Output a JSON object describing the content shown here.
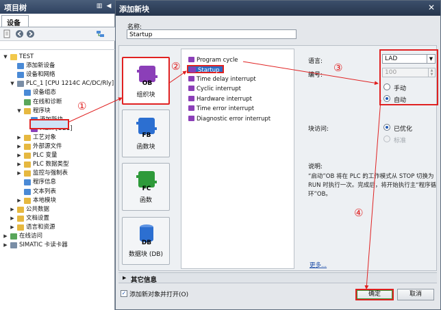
{
  "project_panel": {
    "title": "项目树",
    "tab": "设备",
    "tree": [
      {
        "label": "TEST",
        "indent": 0,
        "arrow": "▼",
        "icon": "project-icon",
        "color": "#f2c84b"
      },
      {
        "label": "添加新设备",
        "indent": 1,
        "arrow": "",
        "icon": "add-device-icon",
        "color": "#4a8ad6"
      },
      {
        "label": "设备和网络",
        "indent": 1,
        "arrow": "",
        "icon": "network-icon",
        "color": "#4a8ad6"
      },
      {
        "label": "PLC_1 [CPU 1214C AC/DC/Rly]",
        "indent": 1,
        "arrow": "▼",
        "icon": "plc-icon",
        "color": "#7a8ea6"
      },
      {
        "label": "设备组态",
        "indent": 2,
        "arrow": "",
        "icon": "device-config-icon",
        "color": "#4a8ad6"
      },
      {
        "label": "在线和诊断",
        "indent": 2,
        "arrow": "",
        "icon": "online-diagnostics-icon",
        "color": "#5aa65a"
      },
      {
        "label": "程序块",
        "indent": 2,
        "arrow": "▼",
        "icon": "folder-icon",
        "color": "#e6b840"
      },
      {
        "label": "添加新块",
        "indent": 3,
        "arrow": "",
        "icon": "add-block-icon",
        "color": "#4a8ad6"
      },
      {
        "label": "Main [OB1]",
        "indent": 3,
        "arrow": "",
        "icon": "ob-block-icon",
        "color": "#8b3fb8"
      },
      {
        "label": "工艺对象",
        "indent": 2,
        "arrow": "▶",
        "icon": "folder-icon",
        "color": "#e6b840"
      },
      {
        "label": "外部源文件",
        "indent": 2,
        "arrow": "▶",
        "icon": "folder-icon",
        "color": "#e6b840"
      },
      {
        "label": "PLC 变量",
        "indent": 2,
        "arrow": "▶",
        "icon": "folder-icon",
        "color": "#e6b840"
      },
      {
        "label": "PLC 数据类型",
        "indent": 2,
        "arrow": "▶",
        "icon": "folder-icon",
        "color": "#e6b840"
      },
      {
        "label": "监控与强制表",
        "indent": 2,
        "arrow": "▶",
        "icon": "folder-icon",
        "color": "#e6b840"
      },
      {
        "label": "程序信息",
        "indent": 2,
        "arrow": "",
        "icon": "program-info-icon",
        "color": "#4a8ad6"
      },
      {
        "label": "文本列表",
        "indent": 2,
        "arrow": "",
        "icon": "text-list-icon",
        "color": "#4a8ad6"
      },
      {
        "label": "本地模块",
        "indent": 2,
        "arrow": "▶",
        "icon": "folder-icon",
        "color": "#e6b840"
      },
      {
        "label": "公共数据",
        "indent": 1,
        "arrow": "▶",
        "icon": "folder-icon",
        "color": "#e6b840"
      },
      {
        "label": "文档设置",
        "indent": 1,
        "arrow": "▶",
        "icon": "folder-icon",
        "color": "#e6b840"
      },
      {
        "label": "语言和资源",
        "indent": 1,
        "arrow": "▶",
        "icon": "folder-icon",
        "color": "#e6b840"
      },
      {
        "label": "在线访问",
        "indent": 0,
        "arrow": "▶",
        "icon": "online-access-icon",
        "color": "#5aa65a"
      },
      {
        "label": "SIMATIC 卡读卡器",
        "indent": 0,
        "arrow": "▶",
        "icon": "card-reader-icon",
        "color": "#7a8ea6"
      }
    ]
  },
  "dialog": {
    "title": "添加新块",
    "close": "✕",
    "name_label": "名称:",
    "name_value": "Startup",
    "block_types": [
      {
        "code": "OB",
        "label": "组织块",
        "color": "#8b3fb8",
        "icon": "organization-block-icon"
      },
      {
        "code": "FB",
        "label": "函数块",
        "color": "#2c6fd1",
        "icon": "function-block-icon"
      },
      {
        "code": "FC",
        "label": "函数",
        "color": "#2e9a3a",
        "icon": "function-icon"
      },
      {
        "code": "DB",
        "label": "数据块 (DB)",
        "color": "#2c6fd1",
        "icon": "data-block-icon"
      }
    ],
    "ob_types": [
      "Program cycle",
      "Startup",
      "Time delay interrupt",
      "Cyclic interrupt",
      "Hardware interrupt",
      "Time error interrupt",
      "Diagnostic error interrupt"
    ],
    "language_label": "语言:",
    "language_value": "LAD",
    "number_label": "编号:",
    "number_value": "100",
    "radio_manual": "手动",
    "radio_auto": "自动",
    "access_label": "块访问:",
    "radio_optimized": "已优化",
    "radio_standard": "标准",
    "desc_label": "说明:",
    "desc_text": "“启动”OB 将在 PLC 的工作模式从 STOP 切换为 RUN 时执行一次。完成后，将开始执行主“程序循环”OB。",
    "more_link": "更多...",
    "more_info": "其它信息",
    "add_open_label": "添加新对象并打开(O)",
    "ok": "确定",
    "cancel": "取消"
  },
  "steps": [
    "①",
    "②",
    "③",
    "④"
  ],
  "colors": {
    "annotation": "#e02020",
    "title_bar": "#2f4260",
    "selection": "#2f6cc4"
  }
}
